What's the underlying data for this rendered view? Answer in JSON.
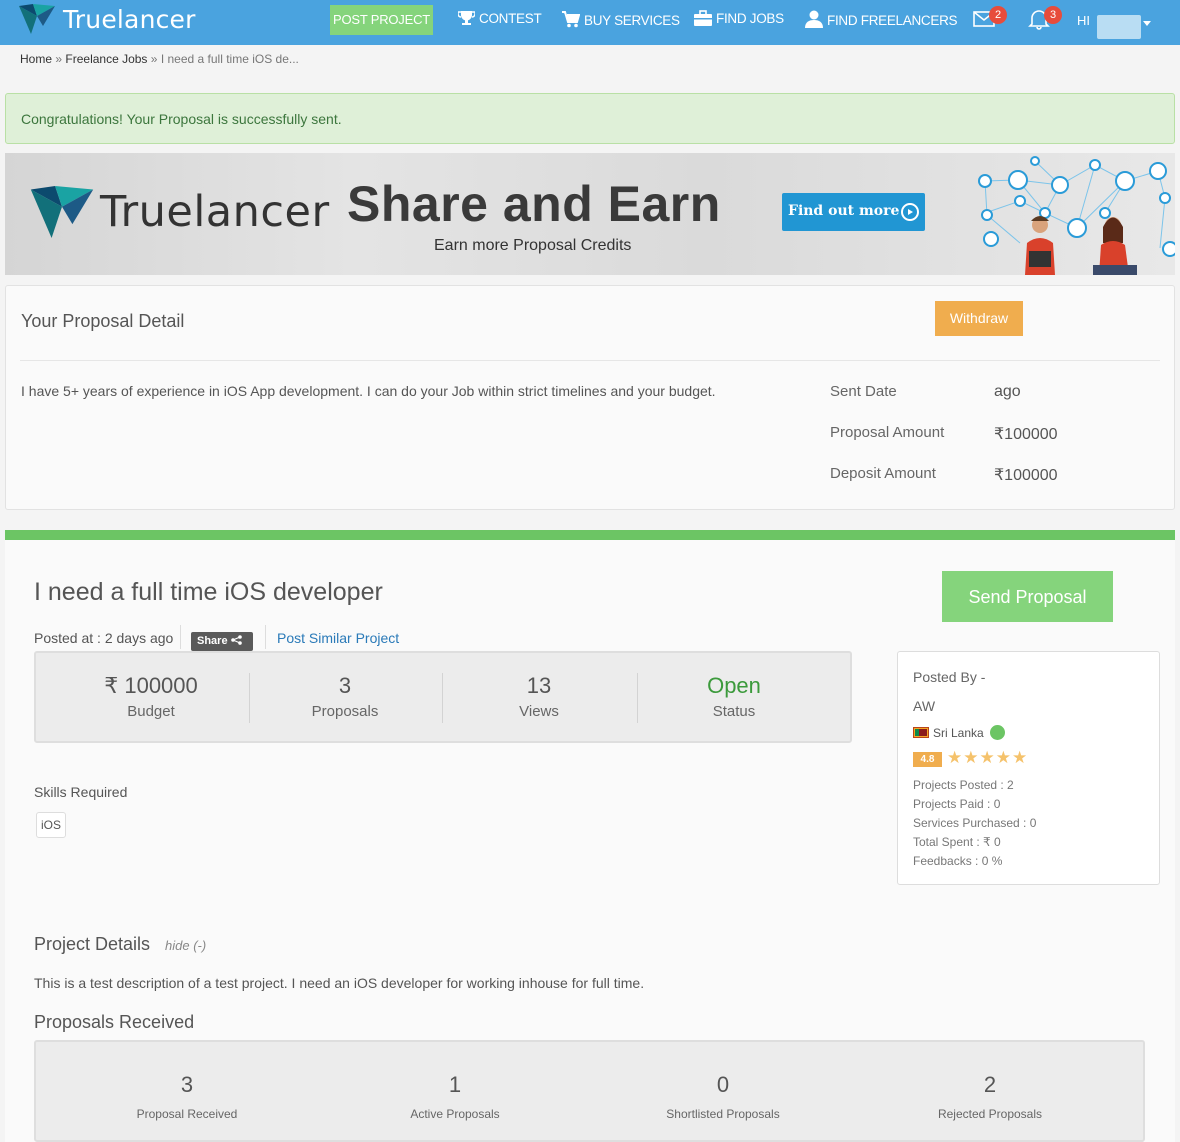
{
  "nav": {
    "brand": "Truelancer",
    "post_project": "POST PROJECT",
    "contest": "CONTEST",
    "buy_services": "BUY SERVICES",
    "find_jobs": "FIND JOBS",
    "find_freelancers": "FIND FREELANCERS",
    "messages_count": "2",
    "notifications_count": "3",
    "greeting": "HI",
    "accent_color": "#4aa3df"
  },
  "breadcrumb": {
    "home": "Home",
    "sep": "»",
    "freelance_jobs": "Freelance Jobs",
    "current": "I need a full time iOS de..."
  },
  "alert": {
    "text": "Congratulations! Your Proposal is successfully sent."
  },
  "banner": {
    "brand": "Truelancer",
    "title": "Share and Earn",
    "subtitle": "Earn more Proposal Credits",
    "button": "Find out more"
  },
  "proposal": {
    "title": "Your Proposal Detail",
    "withdraw": "Withdraw",
    "text": "I have 5+ years of experience in iOS App development. I can do your Job within strict timelines and your budget.",
    "sent_date_label": "Sent Date",
    "sent_date_value": "ago",
    "amount_label": "Proposal Amount",
    "amount_value": "₹100000",
    "deposit_label": "Deposit Amount",
    "deposit_value": "₹100000"
  },
  "project": {
    "title": "I need a full time iOS developer",
    "send_proposal": "Send Proposal",
    "posted_at": "Posted at : 2 days ago",
    "share": "Share",
    "post_similar": "Post Similar Project",
    "stats": [
      {
        "value": "₹ 100000",
        "label": "Budget"
      },
      {
        "value": "3",
        "label": "Proposals"
      },
      {
        "value": "13",
        "label": "Views"
      },
      {
        "value": "Open",
        "label": "Status"
      }
    ],
    "skills_label": "Skills Required",
    "skills": [
      "iOS"
    ],
    "details_title": "Project Details",
    "hide": "hide (-)",
    "details_text": "This is a test description of a test project. I need an iOS developer for working inhouse for full time.",
    "received_title": "Proposals Received",
    "received": [
      {
        "value": "3",
        "label": "Proposal Received"
      },
      {
        "value": "1",
        "label": "Active Proposals"
      },
      {
        "value": "0",
        "label": "Shortlisted Proposals"
      },
      {
        "value": "2",
        "label": "Rejected Proposals"
      }
    ]
  },
  "posted_by": {
    "heading": "Posted By -",
    "name": "AW",
    "location": "Sri Lanka",
    "rating": "4.8",
    "stars": "★★★★★",
    "projects_posted": "Projects Posted : 2",
    "projects_paid": "Projects Paid : 0",
    "services_purchased": "Services Purchased : 0",
    "total_spent": "Total Spent : ₹ 0",
    "feedbacks": "Feedbacks : 0 %"
  }
}
